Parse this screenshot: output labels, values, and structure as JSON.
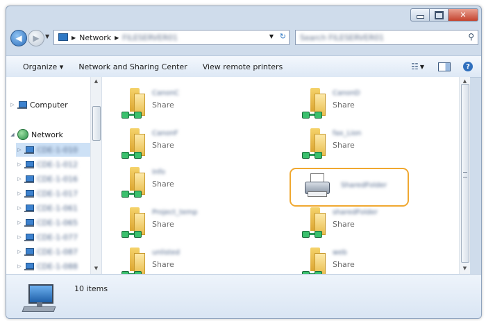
{
  "window": {
    "caption_buttons": [
      "minimize",
      "maximize",
      "close"
    ]
  },
  "address_bar": {
    "breadcrumbs": [
      "Network",
      "FILESERVER01"
    ],
    "search_placeholder": "Search FILESERVER01"
  },
  "toolbar": {
    "organize": "Organize ▾",
    "network_center": "Network and Sharing Center",
    "view_printers": "View remote printers"
  },
  "nav": {
    "computer": "Computer",
    "network": "Network",
    "machines": [
      "CDE-1-010",
      "CDE-1-012",
      "CDE-1-016",
      "CDE-1-017",
      "CDE-1-061",
      "CDE-1-065",
      "CDE-1-077",
      "CDE-1-087",
      "CDE-1-088"
    ]
  },
  "items": [
    {
      "name": "CanonC",
      "sub": "Share"
    },
    {
      "name": "CanonD",
      "sub": "Share"
    },
    {
      "name": "CanonF",
      "sub": "Share"
    },
    {
      "name": "fax_Lion",
      "sub": "Share"
    },
    {
      "name": "Info",
      "sub": "Share"
    },
    {
      "name": "Project_temp",
      "sub": "Share"
    },
    {
      "name": "sharedFolder",
      "sub": "Share"
    },
    {
      "name": "unlisted",
      "sub": "Share"
    },
    {
      "name": "web",
      "sub": "Share"
    }
  ],
  "printer_item": {
    "name": "SharedFolder"
  },
  "details": {
    "count": "10 items"
  }
}
